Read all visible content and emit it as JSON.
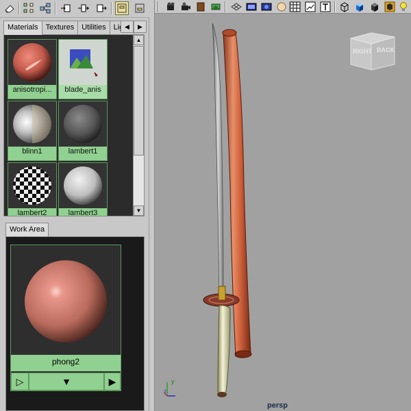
{
  "toolbar": {
    "icons": [
      "eraser-icon",
      "graph-icon",
      "network-icon",
      "input-icon",
      "input-output-icon",
      "output-icon",
      "layout-top-icon",
      "layout-bottom-icon"
    ]
  },
  "hypershade": {
    "tabs": [
      "Materials",
      "Textures",
      "Utilities",
      "Lig..."
    ],
    "materials": [
      {
        "name": "anisotropi...",
        "kind": "aniso"
      },
      {
        "name": "blade_anis",
        "kind": "texture"
      },
      {
        "name": "blinn1",
        "kind": "blinn"
      },
      {
        "name": "lambert1",
        "kind": "lambert-dark"
      },
      {
        "name": "lambert2",
        "kind": "checker"
      },
      {
        "name": "lambert3",
        "kind": "lambert-light"
      }
    ]
  },
  "work_area": {
    "tab": "Work Area",
    "material": "phong2"
  },
  "viewport": {
    "camera": "persp",
    "viewcube": {
      "right": "RIGHT",
      "back": "BACK"
    },
    "axes": {
      "y": "y",
      "z": "z"
    }
  },
  "colors": {
    "swatch_label": "#90d090",
    "viewport_bg": "#a1a1a1",
    "scabbard": "#d66a45"
  }
}
